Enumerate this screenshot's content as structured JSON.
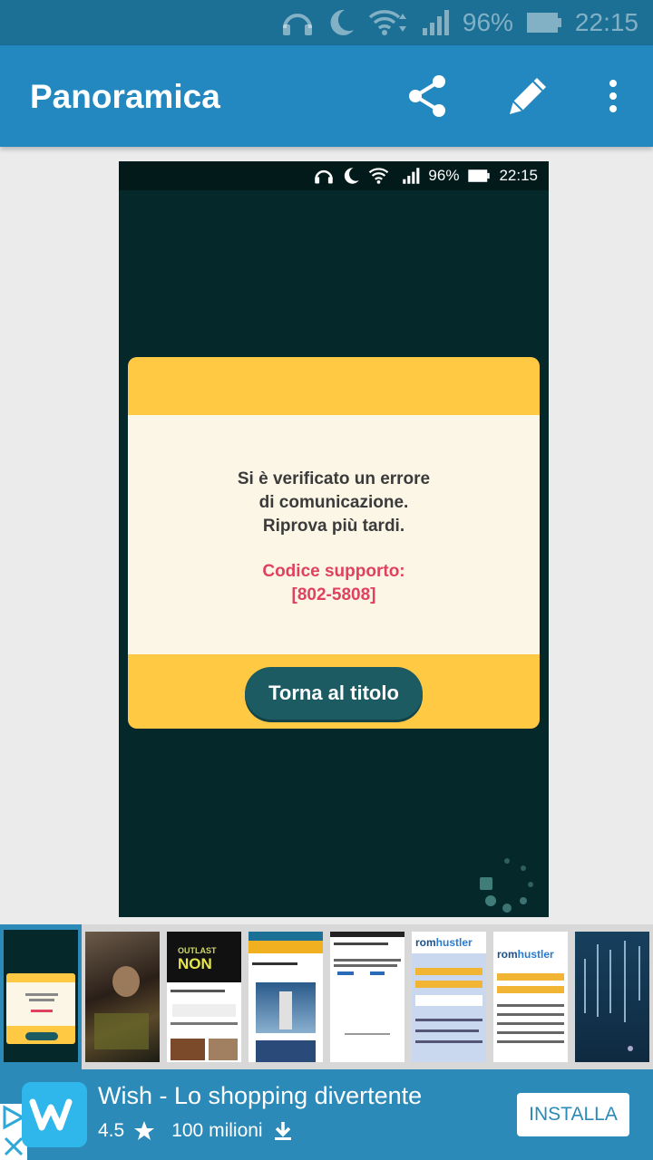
{
  "status_bar": {
    "battery": "96%",
    "time": "22:15"
  },
  "app_bar": {
    "title": "Panoramica",
    "icons": [
      "share-icon",
      "pencil-icon",
      "more-vert-icon"
    ]
  },
  "preview": {
    "status": {
      "battery": "96%",
      "time": "22:15"
    },
    "dialog": {
      "message_lines": [
        "Si è verificato un errore",
        "di comunicazione.",
        "Riprova più tardi."
      ],
      "support_label": "Codice supporto:",
      "support_code": "[802-5808]",
      "button_label": "Torna al titolo"
    },
    "colors": {
      "background": "#05282b",
      "dialog_header": "#ffc943",
      "dialog_body": "#fbf6e6",
      "error_text": "#e0415e",
      "button": "#1d5b63"
    }
  },
  "thumbnails": {
    "thumb2_texts": [
      "OUTLAST",
      "NON"
    ],
    "thumb6_brand": [
      "rom",
      "hustler"
    ],
    "thumb7_brand": [
      "rom",
      "hustler"
    ]
  },
  "ad": {
    "title": "Wish - Lo shopping divertente",
    "rating": "4.5",
    "downloads": "100 milioni",
    "install_label": "INSTALLA"
  }
}
